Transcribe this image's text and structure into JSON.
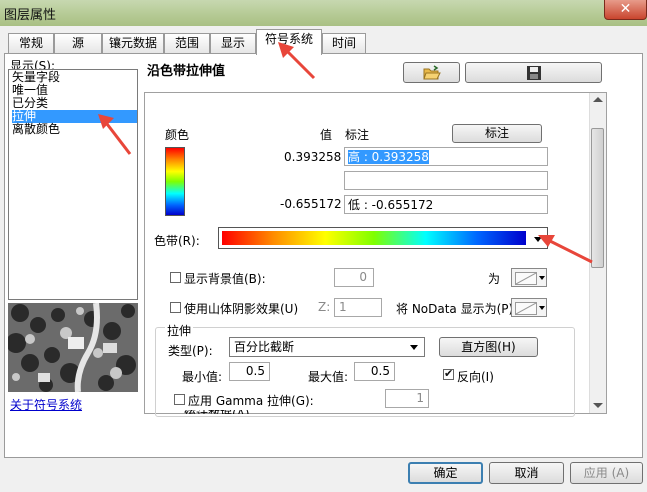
{
  "window": {
    "title": "图层属性",
    "close_label": "✕"
  },
  "tabs": [
    {
      "label": "常规"
    },
    {
      "label": "源"
    },
    {
      "label": "镶元数据"
    },
    {
      "label": "范围"
    },
    {
      "label": "显示"
    },
    {
      "label": "符号系统",
      "active": true
    },
    {
      "label": "时间"
    }
  ],
  "left": {
    "show_label": "显示(S):",
    "items": [
      "矢量字段",
      "唯一值",
      "已分类",
      "拉伸",
      "离散颜色"
    ],
    "selected_index": 3,
    "about_link": "关于符号系统"
  },
  "main": {
    "heading": "沿色带拉伸值",
    "col_color": "颜色",
    "col_value": "值",
    "col_label": "标注",
    "label_button": "标注",
    "high_value": "0.393258",
    "high_label": "高 : 0.393258",
    "mid_label": "",
    "low_value": "-0.655172",
    "low_label": "低 : -0.655172",
    "ramp_label": "色带(R):",
    "bg_checkbox": "显示背景值(B):",
    "bg_value": "0",
    "bg_as": "为",
    "hillshade_checkbox": "使用山体阴影效果(U)",
    "z_label": "Z:",
    "z_value": "1",
    "nodata_label": "将 NoData 显示为(P)",
    "stretch_group": "拉伸",
    "type_label": "类型(P):",
    "type_value": "百分比截断",
    "histogram_button": "直方图(H)",
    "min_label": "最小值:",
    "min_value": "0.5",
    "max_label": "最大值:",
    "max_value": "0.5",
    "invert_label": "反向(I)",
    "invert_checked": true,
    "gamma_label": "应用 Gamma 拉伸(G):",
    "gamma_value": "1",
    "cut_text": "统计数据(A)"
  },
  "footer": {
    "ok": "确定",
    "cancel": "取消",
    "apply": "应用 (A)"
  },
  "colors": {
    "accent": "#3399ff",
    "annotation_arrow": "#e8463a"
  }
}
